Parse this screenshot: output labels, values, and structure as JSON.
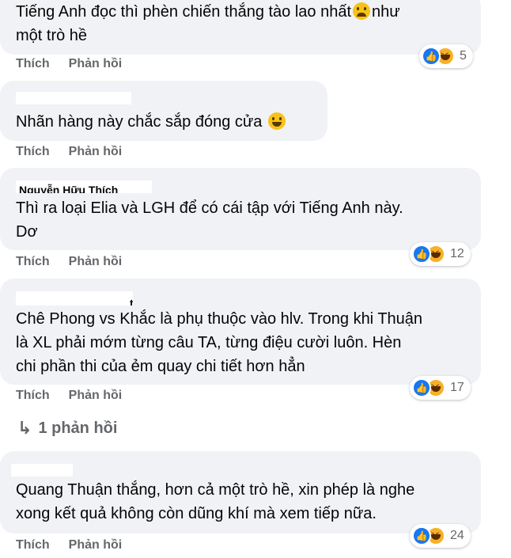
{
  "actions": {
    "like": "Thích",
    "reply": "Phản hồi"
  },
  "comments": [
    {
      "name": "",
      "lines": [
        "Tiếng Anh đọc thì phèn chiến thắng tào lao nhất",
        "như",
        "một trò hề"
      ],
      "reactions": "5"
    },
    {
      "name": "",
      "text": "Nhãn hàng này chắc sắp đóng cửa",
      "reactions": ""
    },
    {
      "name": "Nguyễn Hữu Thích",
      "text": "Thì ra loại Elia và LGH để có cái tập với Tiếng Anh này.\nDơ",
      "reactions": "12"
    },
    {
      "name": "t",
      "text": "Chê Phong vs Khắc là phụ thuộc vào hlv. Trong khi Thuận\nlà XL phải mớm từng câu TA, từng điệu cười luôn. Hèn\nchi phần thi của ẻm quay chi tiết hơn hẳn",
      "reactions": "17"
    },
    {
      "name": "",
      "text": "Quang Thuận thắng, hơn cả một trò hề, xin phép là nghe\nxong kết quả không còn dũng khí mà xem tiếp nữa.",
      "reactions": "24"
    }
  ],
  "replies_link": "1 phản hồi",
  "icons": {
    "like": "thumbs-up-icon",
    "haha": "laughing-face-icon",
    "reply_arrow": "reply-arrow-icon"
  },
  "colors": {
    "bubble": "#f0f2f5",
    "like_blue": "#1877f2",
    "haha_yellow": "#f7b125",
    "muted": "#65676b"
  }
}
